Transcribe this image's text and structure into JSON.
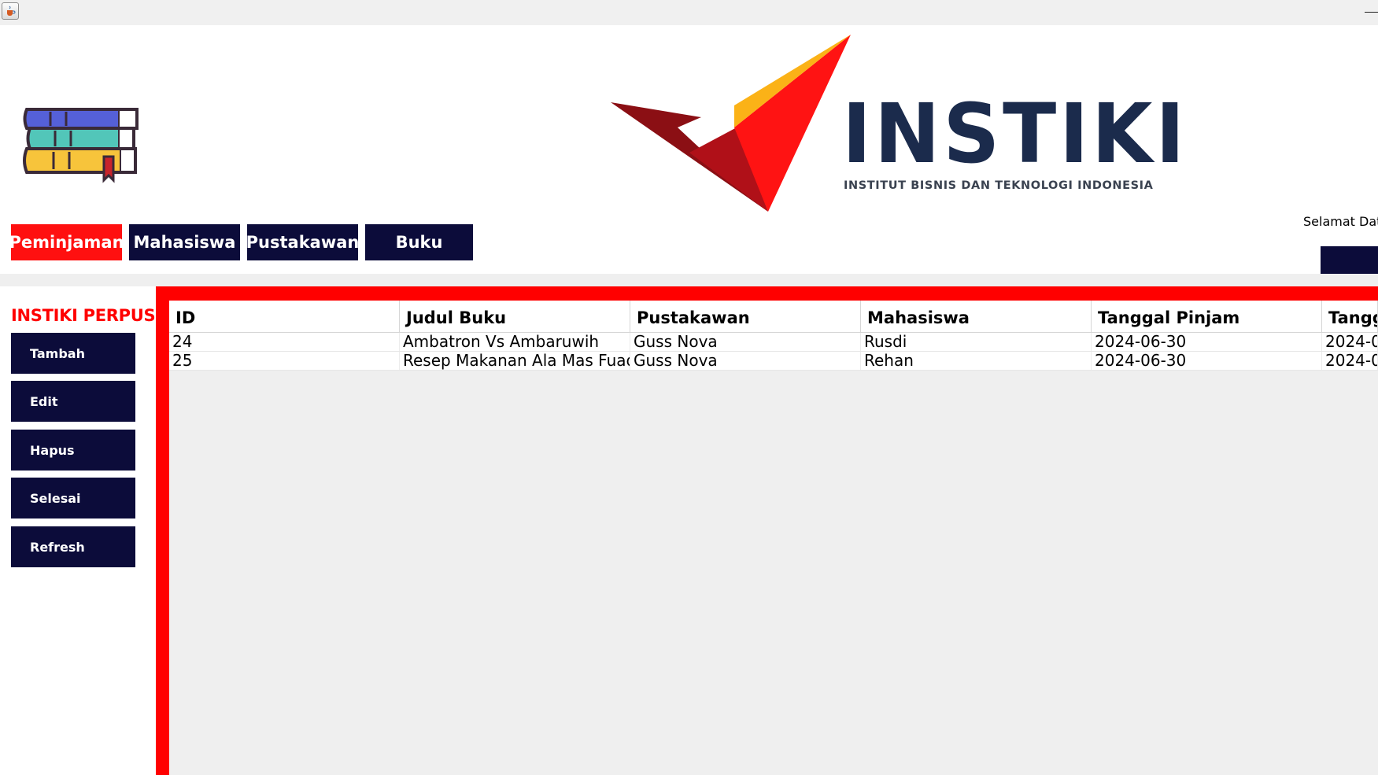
{
  "window": {
    "icon": "java-cup-icon"
  },
  "header": {
    "logo": {
      "name": "INSTIKI",
      "subtitle": "INSTITUT BISNIS DAN TEKNOLOGI INDONESIA"
    },
    "nav": [
      {
        "label": "Peminjaman",
        "active": true
      },
      {
        "label": "Mahasiswa",
        "active": false
      },
      {
        "label": "Pustakawan",
        "active": false
      },
      {
        "label": "Buku",
        "active": false
      }
    ],
    "welcome": "Selamat Dat"
  },
  "sidebar": {
    "brand": "INSTIKI PERPUS",
    "buttons": [
      "Tambah",
      "Edit",
      "Hapus",
      "Selesai",
      "Refresh"
    ]
  },
  "table": {
    "columns": [
      "ID",
      "Judul Buku",
      "Pustakawan",
      "Mahasiswa",
      "Tanggal Pinjam",
      "Tangg"
    ],
    "rows": [
      [
        "24",
        "Ambatron Vs Ambaruwih",
        "Guss Nova",
        "Rusdi",
        "2024-06-30",
        "2024-0"
      ],
      [
        "25",
        "Resep Makanan Ala Mas Fuad",
        "Guss Nova",
        "Rehan",
        "2024-06-30",
        "2024-0"
      ]
    ]
  },
  "colors": {
    "accent": "#ff1010",
    "navy": "#0c0c3a",
    "logo_text": "#1b2b4c"
  }
}
